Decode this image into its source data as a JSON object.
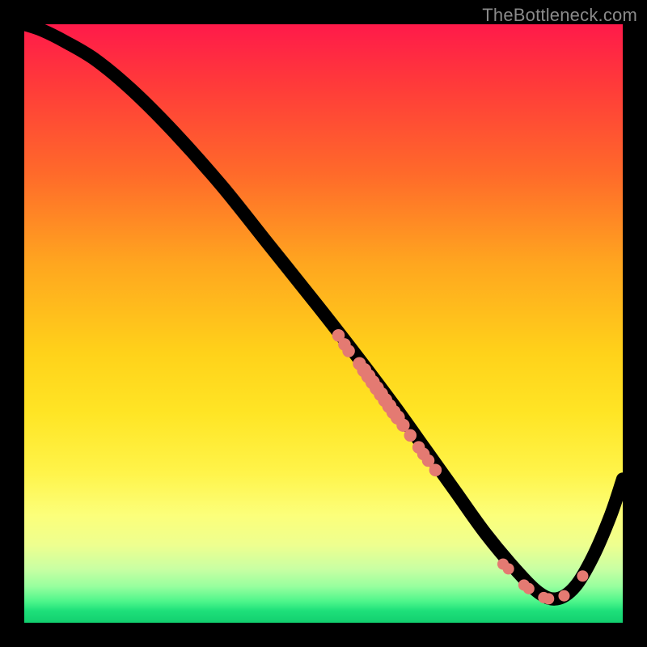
{
  "attribution": "TheBottleneck.com",
  "chart_data": {
    "type": "line",
    "title": "",
    "xlabel": "",
    "ylabel": "",
    "xlim": [
      0,
      100
    ],
    "ylim": [
      0,
      100
    ],
    "grid": false,
    "series": [
      {
        "name": "curve",
        "x": [
          0,
          3,
          7,
          12,
          18,
          25,
          33,
          41,
          49,
          56,
          62,
          67,
          72,
          77,
          82,
          86,
          89,
          92,
          95,
          98,
          100
        ],
        "y": [
          100,
          99,
          97,
          94,
          89,
          82,
          73,
          63,
          53,
          44,
          36,
          29,
          22,
          15,
          9,
          5,
          4,
          6,
          11,
          18,
          24
        ]
      }
    ],
    "markers": [
      {
        "x": 52.5,
        "y": 48.0,
        "r": 1.05
      },
      {
        "x": 53.5,
        "y": 46.5,
        "r": 1.05
      },
      {
        "x": 54.2,
        "y": 45.4,
        "r": 1.05
      },
      {
        "x": 56.0,
        "y": 43.3,
        "r": 1.1
      },
      {
        "x": 56.8,
        "y": 42.2,
        "r": 1.2
      },
      {
        "x": 57.5,
        "y": 41.2,
        "r": 1.2
      },
      {
        "x": 58.2,
        "y": 40.2,
        "r": 1.2
      },
      {
        "x": 58.9,
        "y": 39.2,
        "r": 1.2
      },
      {
        "x": 59.6,
        "y": 38.2,
        "r": 1.2
      },
      {
        "x": 60.3,
        "y": 37.2,
        "r": 1.2
      },
      {
        "x": 61.0,
        "y": 36.2,
        "r": 1.2
      },
      {
        "x": 61.7,
        "y": 35.2,
        "r": 1.2
      },
      {
        "x": 62.4,
        "y": 34.3,
        "r": 1.2
      },
      {
        "x": 63.3,
        "y": 33.0,
        "r": 1.1
      },
      {
        "x": 64.5,
        "y": 31.3,
        "r": 1.05
      },
      {
        "x": 65.9,
        "y": 29.3,
        "r": 1.05
      },
      {
        "x": 66.7,
        "y": 28.2,
        "r": 1.05
      },
      {
        "x": 67.5,
        "y": 27.1,
        "r": 1.05
      },
      {
        "x": 68.7,
        "y": 25.5,
        "r": 1.05
      },
      {
        "x": 80.0,
        "y": 9.8,
        "r": 0.95
      },
      {
        "x": 80.9,
        "y": 9.0,
        "r": 0.95
      },
      {
        "x": 83.5,
        "y": 6.3,
        "r": 0.95
      },
      {
        "x": 84.3,
        "y": 5.7,
        "r": 0.95
      },
      {
        "x": 86.8,
        "y": 4.2,
        "r": 0.95
      },
      {
        "x": 87.6,
        "y": 4.0,
        "r": 0.95
      },
      {
        "x": 90.2,
        "y": 4.5,
        "r": 0.95
      },
      {
        "x": 93.3,
        "y": 7.8,
        "r": 0.95
      }
    ]
  }
}
